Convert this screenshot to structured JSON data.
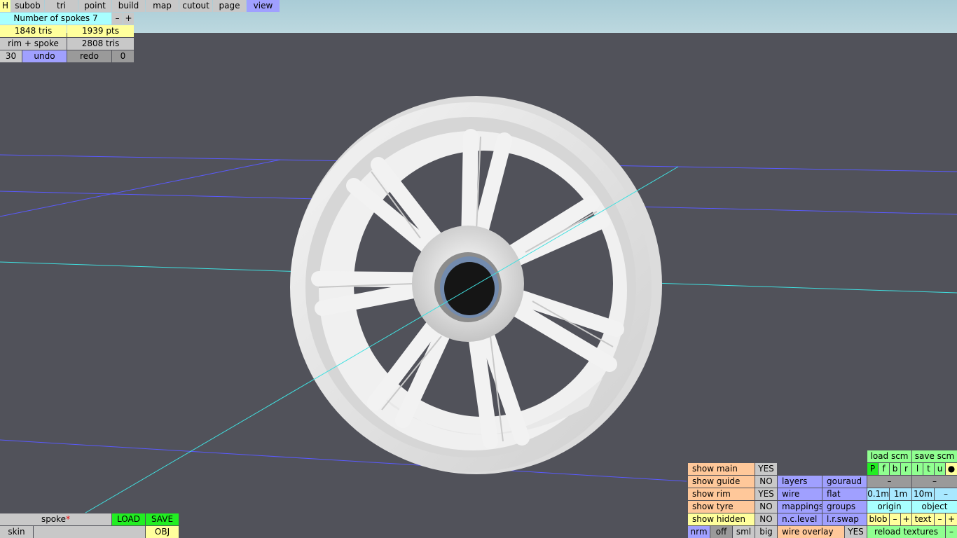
{
  "menu": {
    "items": [
      "H",
      "subob",
      "tri",
      "point",
      "build",
      "map",
      "cutout",
      "page",
      "view"
    ],
    "active": "view"
  },
  "info": {
    "spokes_label": "Number of spokes 7",
    "minus": "–",
    "plus": "+",
    "tris": "1848 tris",
    "pts": "1939 pts",
    "rim_spoke": "rim + spoke",
    "tris2": "2808 tris",
    "undo_count": "30",
    "undo": "undo",
    "redo": "redo",
    "redo_count": "0"
  },
  "bottom_left": {
    "object_name": "spoke",
    "modified_mark": "*",
    "load": "LOAD",
    "save": "SAVE",
    "skin": "skin",
    "obj": "OBJ"
  },
  "panel": {
    "toggles": [
      {
        "label": "show main",
        "value": "YES"
      },
      {
        "label": "show guide",
        "value": "NO"
      },
      {
        "label": "show rim",
        "value": "YES"
      },
      {
        "label": "show tyre",
        "value": "NO"
      },
      {
        "label": "show hidden",
        "value": "NO"
      }
    ],
    "render": {
      "layers": "layers",
      "gouraud": "gouraud",
      "wire": "wire",
      "flat": "flat",
      "mappings": "mappings",
      "groups": "groups",
      "nc_level": "n.c.level",
      "lr_swap": "l.r.swap"
    },
    "sizes": {
      "nrm": "nrm",
      "off": "off",
      "sml": "sml",
      "big": "big"
    },
    "wire_overlay": {
      "label": "wire overlay",
      "value": "YES"
    },
    "scm": {
      "load": "load scm",
      "save": "save scm"
    },
    "views": [
      "P",
      "f",
      "b",
      "r",
      "l",
      "t",
      "u",
      "●"
    ],
    "dash1": "–",
    "dash2": "–",
    "grid": {
      "a": "0.1m",
      "b": "1m",
      "c": "10m",
      "minus": "–"
    },
    "origin": "origin",
    "object": "object",
    "blob": {
      "label": "blob",
      "minus": "–",
      "plus": "+"
    },
    "text": {
      "label": "text",
      "minus": "–",
      "plus": "+"
    },
    "reload": {
      "label": "reload textures",
      "minus": "–"
    }
  },
  "colors": {
    "background": "#51525a",
    "sky": "#b0d0d8",
    "grid_line": "#5a5aff",
    "axis_line": "#40e0e0",
    "wheel": "#ececec"
  }
}
